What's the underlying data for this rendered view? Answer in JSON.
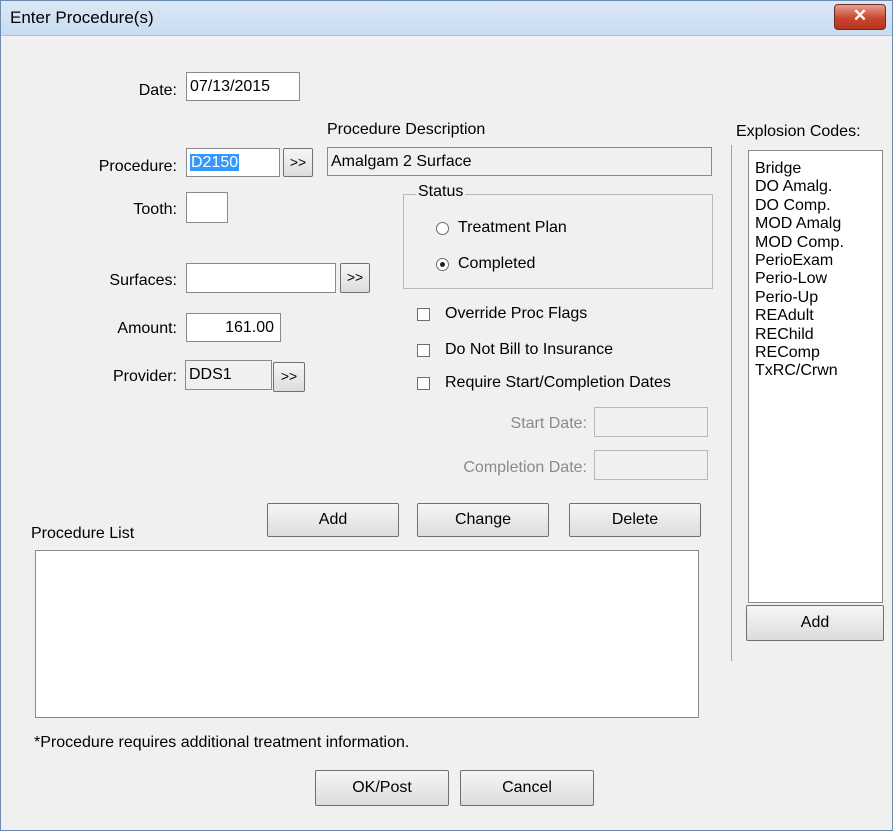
{
  "window": {
    "title": "Enter Procedure(s)",
    "close_glyph": "✕"
  },
  "date": {
    "label": "Date:",
    "value": "07/13/2015"
  },
  "procedure": {
    "label": "Procedure:",
    "value": "D2150",
    "lookup_label": ">>"
  },
  "procedure_description": {
    "label": "Procedure Description",
    "value": "Amalgam 2 Surface"
  },
  "tooth": {
    "label": "Tooth:",
    "value": ""
  },
  "status": {
    "label": "Status",
    "options": [
      {
        "label": "Treatment Plan",
        "selected": false
      },
      {
        "label": "Completed",
        "selected": true
      }
    ]
  },
  "surfaces": {
    "label": "Surfaces:",
    "value": "",
    "lookup_label": ">>"
  },
  "amount": {
    "label": "Amount:",
    "value": "161.00"
  },
  "provider": {
    "label": "Provider:",
    "value": "DDS1",
    "lookup_label": ">>"
  },
  "flags": {
    "override": {
      "label": "Override Proc Flags",
      "checked": false
    },
    "do_not_bill": {
      "label": "Do Not Bill to Insurance",
      "checked": false
    },
    "require_dates": {
      "label": "Require Start/Completion Dates",
      "checked": false
    }
  },
  "start_date": {
    "label": "Start Date:",
    "value": ""
  },
  "completion_date": {
    "label": "Completion Date:",
    "value": ""
  },
  "procedure_list": {
    "label": "Procedure List",
    "add_label": "Add",
    "change_label": "Change",
    "delete_label": "Delete",
    "items": []
  },
  "explosion_codes": {
    "label": "Explosion Codes:",
    "items": [
      "Bridge",
      "DO Amalg.",
      "DO Comp.",
      "MOD Amalg",
      "MOD Comp.",
      "PerioExam",
      "Perio-Low",
      "Perio-Up",
      "REAdult",
      "REChild",
      "REComp",
      "TxRC/Crwn"
    ],
    "add_label": "Add"
  },
  "footnote": "*Procedure requires additional treatment information.",
  "buttons": {
    "ok_label": "OK/Post",
    "cancel_label": "Cancel"
  }
}
